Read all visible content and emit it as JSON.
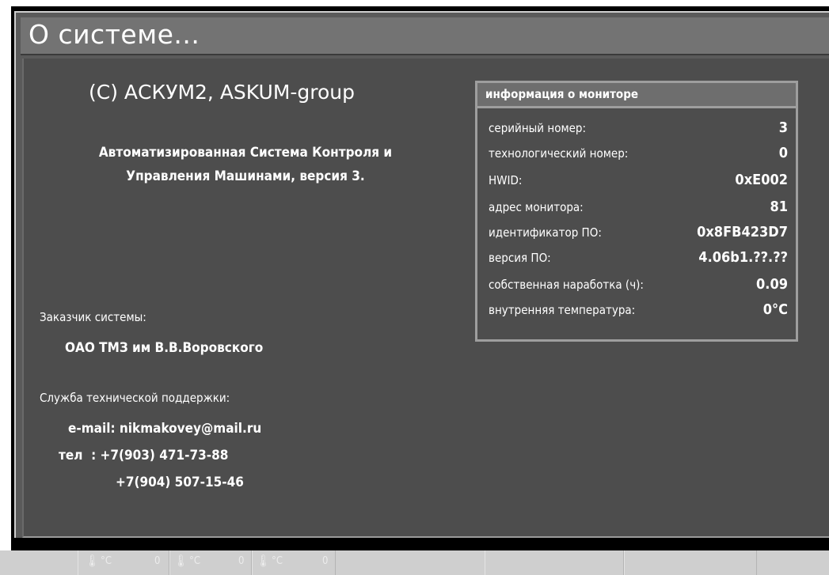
{
  "window": {
    "title": "О системе..."
  },
  "about": {
    "copyright": "(C) АСКУМ2, ASKUM-group",
    "description_line1": "Автоматизированная Система Контроля и",
    "description_line2": "Управления Машинами, версия 3.",
    "customer_label": "Заказчик системы:",
    "customer_value": "ОАО ТМЗ им В.В.Воровского",
    "support_label": "Служба технической поддержки:",
    "email_line": "e-mail: nikmakovey@mail.ru",
    "phone_line1": "тел  : +7(903) 471-73-88",
    "phone_line2": "+7(904) 507-15-46"
  },
  "monitor_info": {
    "title": "информация о мониторе",
    "rows": [
      {
        "label": "серийный номер:",
        "value": "3"
      },
      {
        "label": "технологический номер:",
        "value": "0"
      },
      {
        "label": "HWID:",
        "value": "0xE002"
      },
      {
        "label": "адрес монитора:",
        "value": "81"
      },
      {
        "label": "идентификатор ПО:",
        "value": "0x8FB423D7"
      },
      {
        "label": "версия ПО:",
        "value": "4.06b1.??.??"
      },
      {
        "label": "собственная наработка (ч):",
        "value": "0.09"
      },
      {
        "label": "внутренняя температура:",
        "value": "0°C"
      }
    ]
  },
  "status_bar": {
    "temps": [
      {
        "icon": "thermometer-icon",
        "unit": "°C",
        "value": "0"
      },
      {
        "icon": "thermometer-icon",
        "unit": "°C",
        "value": "0"
      },
      {
        "icon": "thermometer-icon",
        "unit": "°C",
        "value": "0"
      }
    ]
  }
}
